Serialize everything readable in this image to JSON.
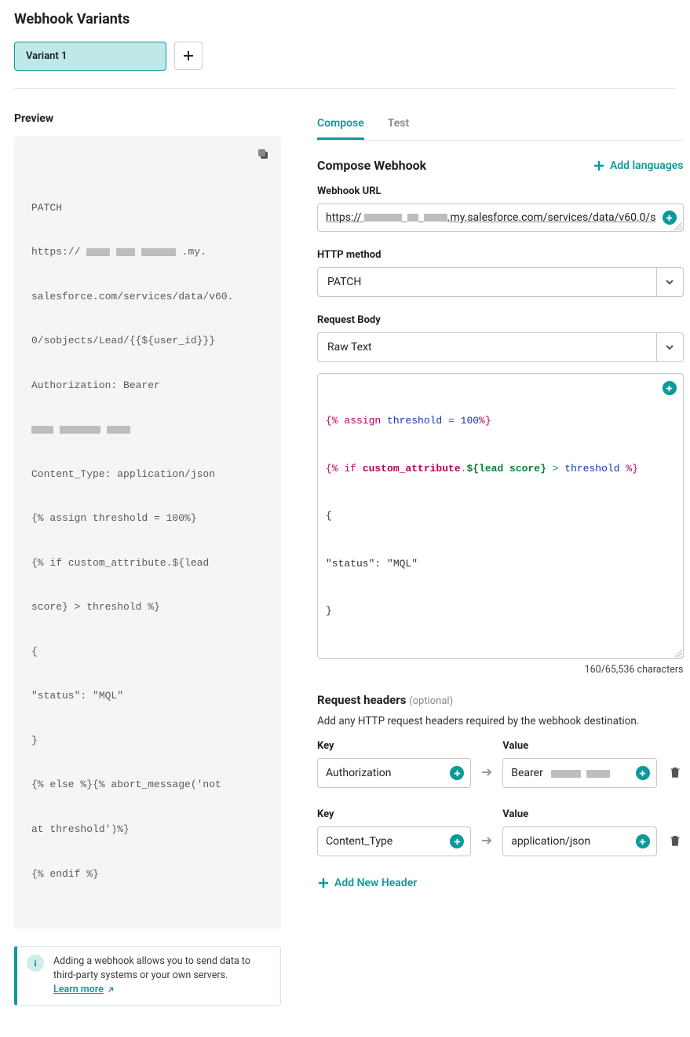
{
  "title": "Webhook Variants",
  "variant_label": "Variant 1",
  "preview_heading": "Preview",
  "info_text": "Adding a webhook allows you to send data to third-party systems or your own servers.",
  "learn_more": "Learn more",
  "tabs": {
    "compose": "Compose",
    "test": "Test"
  },
  "compose_title": "Compose Webhook",
  "add_languages": "Add languages",
  "url_label": "Webhook URL",
  "url_value_pre": "https://",
  "url_value_post": ".my.salesforce.com/services/data/v60.0/s",
  "method_label": "HTTP method",
  "method_value": "PATCH",
  "body_label": "Request Body",
  "body_type": "Raw Text",
  "body_prefix": "{% assign ",
  "body_threshold_word": "threshold",
  "body_eq": " = ",
  "body_val": "100",
  "body_pct_close": "%}",
  "body_if": "{% if ",
  "body_custattr": "custom_attribute",
  "body_dot": ".",
  "body_leadscore": "${lead score}",
  "body_gt": " > ",
  "body_endif_brace": " %}",
  "body_line3": "{",
  "body_line4": "\"status\": \"MQL\"",
  "body_line5": "}",
  "char_counter": "160/65,536 characters",
  "req_headers": "Request headers",
  "optional": "(optional)",
  "req_help": "Add any HTTP request headers required by the webhook destination.",
  "kv_key_label": "Key",
  "kv_val_label": "Value",
  "headers": [
    {
      "key": "Authorization",
      "value_prefix": "Bearer "
    },
    {
      "key": "Content_Type",
      "value_prefix": "application/json"
    }
  ],
  "add_header": "Add New Header",
  "preview": {
    "line1": "PATCH",
    "line2a": "https:// ",
    "line2b": " .my.",
    "line3": "salesforce.com/services/data/v60.",
    "line4": "0/sobjects/Lead/{{${user_id}}}",
    "line5": "Authorization: Bearer",
    "line7": "Content_Type: application/json",
    "line8": "{% assign threshold = 100%}",
    "line9": "{% if custom_attribute.${lead",
    "line10": "score} > threshold %}",
    "line11": "{",
    "line12": "\"status\": \"MQL\"",
    "line13": "}",
    "line14": "{% else %}{% abort_message('not",
    "line15": "at threshold')%}",
    "line16": "{% endif %}"
  }
}
